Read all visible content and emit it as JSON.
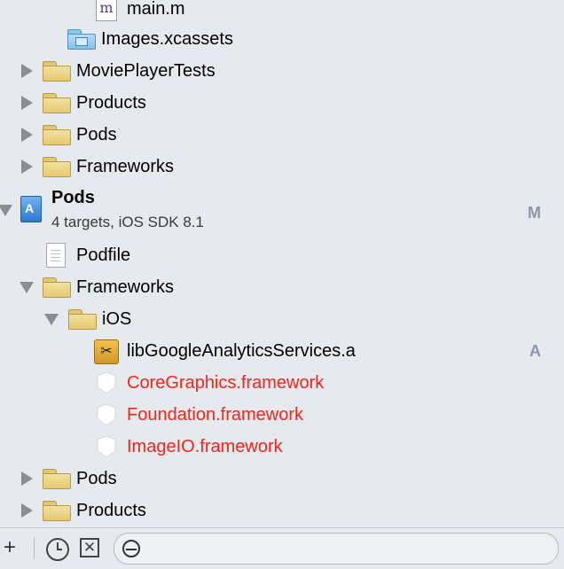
{
  "tree": [
    {
      "label": "main.m",
      "icon": "m-file-icon"
    },
    {
      "label": "Images.xcassets",
      "icon": "xcassets-folder-icon"
    },
    {
      "label": "MoviePlayerTests",
      "icon": "folder-icon"
    },
    {
      "label": "Products",
      "icon": "folder-icon"
    },
    {
      "label": "Pods",
      "icon": "folder-icon"
    },
    {
      "label": "Frameworks",
      "icon": "folder-icon"
    },
    {
      "label": "Pods",
      "sublabel": "4 targets, iOS SDK 8.1",
      "badge": "M",
      "icon": "project-icon"
    },
    {
      "label": "Podfile",
      "icon": "document-icon"
    },
    {
      "label": "Frameworks",
      "icon": "folder-icon"
    },
    {
      "label": "iOS",
      "icon": "folder-icon"
    },
    {
      "label": "libGoogleAnalyticsServices.a",
      "badge": "A",
      "icon": "library-icon"
    },
    {
      "label": "CoreGraphics.framework",
      "icon": "framework-icon",
      "color": "#f0261e"
    },
    {
      "label": "Foundation.framework",
      "icon": "framework-icon",
      "color": "#f0261e"
    },
    {
      "label": "ImageIO.framework",
      "icon": "framework-icon",
      "color": "#f0261e"
    },
    {
      "label": "Pods",
      "icon": "folder-icon"
    },
    {
      "label": "Products",
      "icon": "folder-icon"
    }
  ],
  "bottombar": {
    "add_label": "+",
    "icons": [
      "add-icon",
      "recent-files-clock-icon",
      "scm-status-icon",
      "filter-icon"
    ]
  }
}
